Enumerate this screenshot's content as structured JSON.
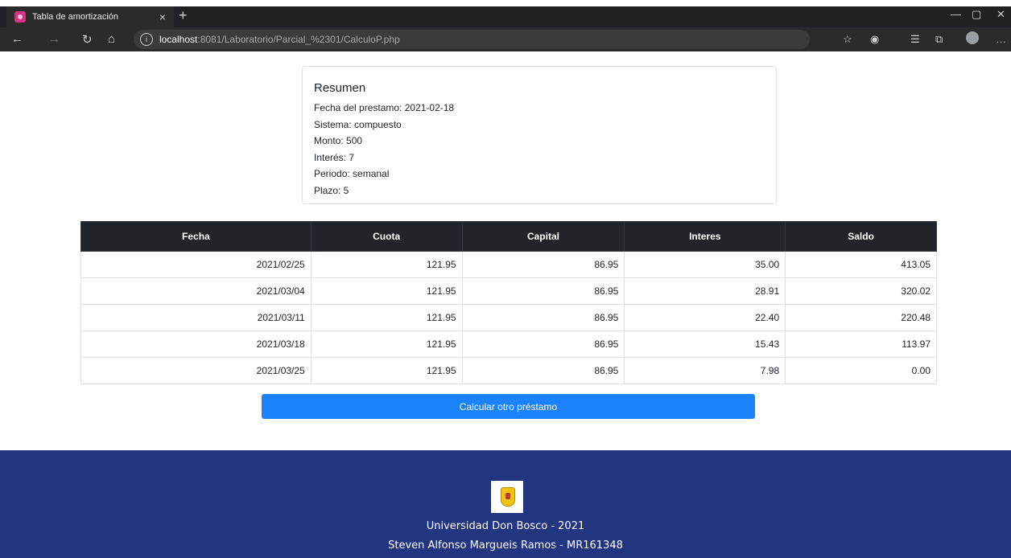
{
  "browser": {
    "tab_title": "Tabla de amortización",
    "tab_close": "×",
    "new_tab": "+",
    "url_host": "localhost",
    "url_path": ":8081/Laboratorio/Parcial_%2301/CalculoP.php"
  },
  "summary": {
    "title": "Resumen",
    "lines": [
      "Fecha del prestamo: 2021-02-18",
      "Sistema: compuesto",
      "Monto: 500",
      "Interés: 7",
      "Periodo: semanal",
      "Plazo: 5"
    ]
  },
  "table": {
    "headers": [
      "Fecha",
      "Cuota",
      "Capital",
      "Interes",
      "Saldo"
    ],
    "rows": [
      [
        "2021/02/25",
        "121.95",
        "86.95",
        "35.00",
        "413.05"
      ],
      [
        "2021/03/04",
        "121.95",
        "86.95",
        "28.91",
        "320.02"
      ],
      [
        "2021/03/11",
        "121.95",
        "86.95",
        "22.40",
        "220.48"
      ],
      [
        "2021/03/18",
        "121.95",
        "86.95",
        "15.43",
        "113.97"
      ],
      [
        "2021/03/25",
        "121.95",
        "86.95",
        "7.98",
        "0.00"
      ]
    ]
  },
  "button": {
    "label": "Calcular otro préstamo"
  },
  "footer": {
    "line1": "Universidad Don Bosco - 2021",
    "line2": "Steven Alfonso Margueis Ramos - MR161348"
  },
  "colors": {
    "primary_button": "#1a82fb",
    "table_header": "#212529",
    "footer_bg": "#213580"
  },
  "icons": [
    "back-icon",
    "forward-icon",
    "refresh-icon",
    "home-icon",
    "info-icon",
    "favorites-add-icon",
    "extension-icon",
    "favorites-icon",
    "collections-icon",
    "profile-icon",
    "more-icon"
  ]
}
